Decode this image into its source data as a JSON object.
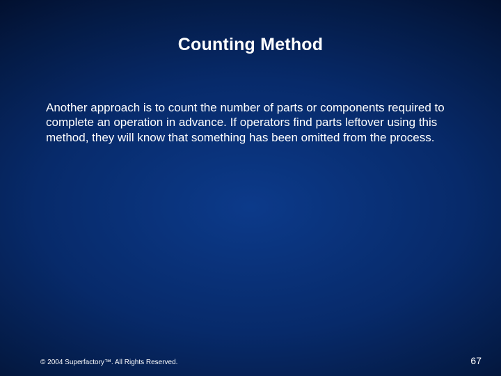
{
  "title": "Counting Method",
  "body": "Another approach is to count the number of parts or components required to complete an operation in advance.  If operators find parts leftover using this method, they will know that something has been omitted from the process.",
  "footer": {
    "copyright": "© 2004 Superfactory™. All Rights Reserved.",
    "page_number": "67"
  }
}
